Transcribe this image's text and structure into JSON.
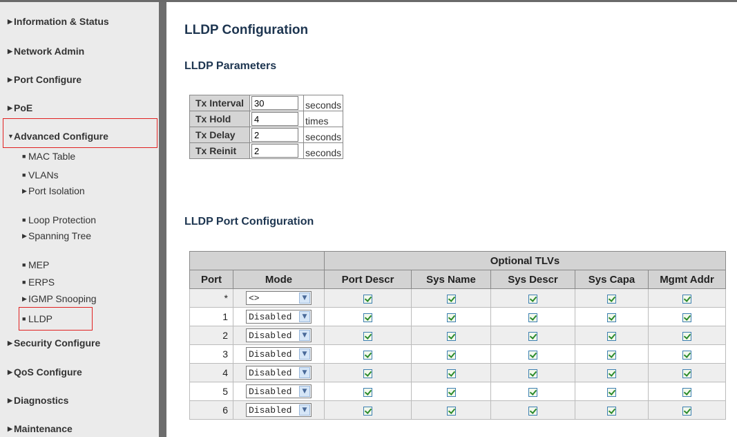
{
  "nav": {
    "information_status": "Information & Status",
    "network_admin": "Network Admin",
    "port_configure": "Port Configure",
    "poe": "PoE",
    "advanced_configure": "Advanced Configure",
    "security_configure": "Security Configure",
    "qos_configure": "QoS Configure",
    "diagnostics": "Diagnostics",
    "maintenance": "Maintenance",
    "sub": {
      "mac_table": "MAC Table",
      "vlans": "VLANs",
      "port_isolation": "Port Isolation",
      "loop_protection": "Loop Protection",
      "spanning_tree": "Spanning Tree",
      "mep": "MEP",
      "erps": "ERPS",
      "igmp_snooping": "IGMP Snooping",
      "lldp": "LLDP"
    }
  },
  "page": {
    "title": "LLDP Configuration",
    "params_heading": "LLDP Parameters",
    "port_config_heading": "LLDP Port Configuration"
  },
  "params": {
    "tx_interval": {
      "label": "Tx Interval",
      "value": "30",
      "unit": "seconds"
    },
    "tx_hold": {
      "label": "Tx Hold",
      "value": "4",
      "unit": "times"
    },
    "tx_delay": {
      "label": "Tx Delay",
      "value": "2",
      "unit": "seconds"
    },
    "tx_reinit": {
      "label": "Tx Reinit",
      "value": "2",
      "unit": "seconds"
    }
  },
  "port_table": {
    "group_header": "Optional TLVs",
    "headers": {
      "port": "Port",
      "mode": "Mode",
      "port_descr": "Port Descr",
      "sys_name": "Sys Name",
      "sys_descr": "Sys Descr",
      "sys_capa": "Sys Capa",
      "mgmt_addr": "Mgmt Addr"
    },
    "rows": [
      {
        "port": "*",
        "mode": "<>"
      },
      {
        "port": "1",
        "mode": "Disabled"
      },
      {
        "port": "2",
        "mode": "Disabled"
      },
      {
        "port": "3",
        "mode": "Disabled"
      },
      {
        "port": "4",
        "mode": "Disabled"
      },
      {
        "port": "5",
        "mode": "Disabled"
      },
      {
        "port": "6",
        "mode": "Disabled"
      }
    ]
  },
  "colors": {
    "highlight": "#e02020",
    "heading": "#1d3550",
    "sidebar_bg": "#ebebeb",
    "divider": "#6d6d6d"
  },
  "icons": {
    "collapsed": "triangle-right-icon",
    "expanded": "triangle-down-icon",
    "bullet": "bullet-icon",
    "dropdown": "chevron-down-icon",
    "checked": "checkbox-checked-icon"
  }
}
